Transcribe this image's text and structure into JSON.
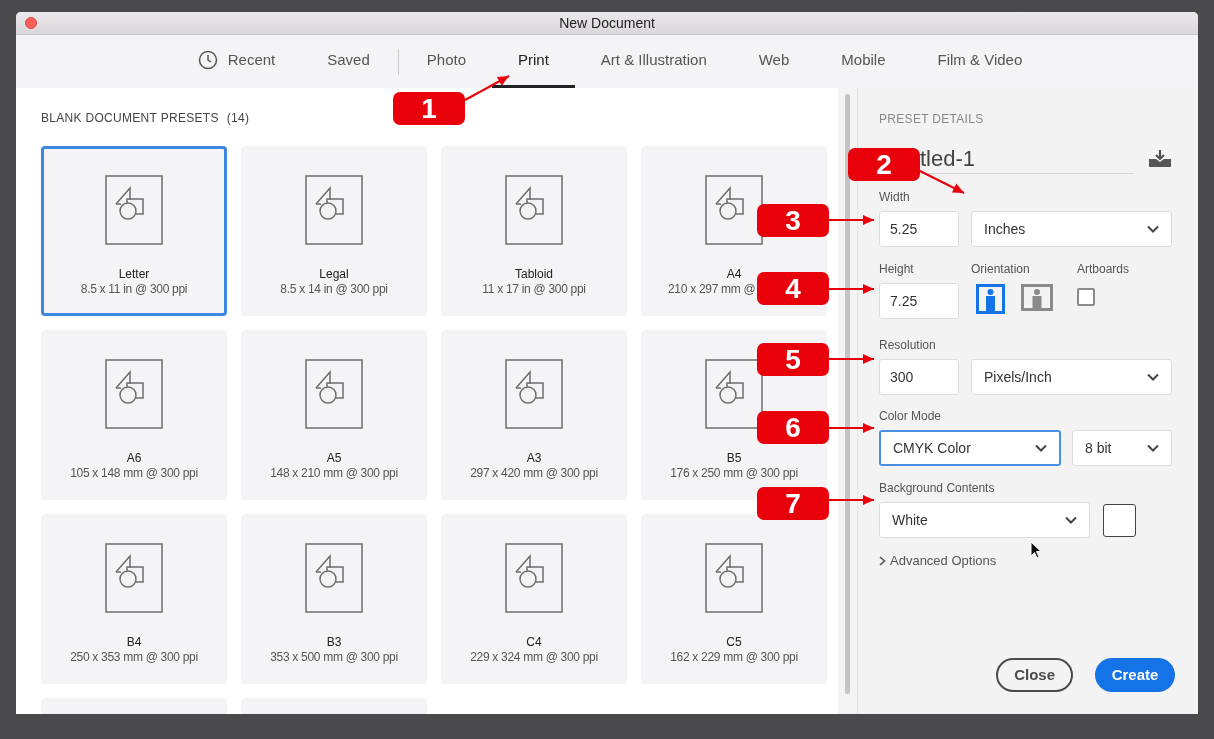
{
  "window": {
    "title": "New Document"
  },
  "tabs": [
    {
      "label": "Recent",
      "kind": "recent",
      "selected": false
    },
    {
      "label": "Saved",
      "kind": "plain",
      "selected": false
    },
    {
      "label": "Photo",
      "kind": "divided",
      "selected": false
    },
    {
      "label": "Print",
      "kind": "plain",
      "selected": true
    },
    {
      "label": "Art & Illustration",
      "kind": "plain",
      "selected": false
    },
    {
      "label": "Web",
      "kind": "plain",
      "selected": false
    },
    {
      "label": "Mobile",
      "kind": "plain",
      "selected": false
    },
    {
      "label": "Film & Video",
      "kind": "plain",
      "selected": false
    }
  ],
  "presets": {
    "heading": "BLANK DOCUMENT PRESETS",
    "count": "(14)",
    "items": [
      {
        "name": "Letter",
        "size": "8.5 x 11 in @ 300 ppi",
        "selected": true
      },
      {
        "name": "Legal",
        "size": "8.5 x 14 in @ 300 ppi",
        "selected": false
      },
      {
        "name": "Tabloid",
        "size": "11 x 17 in @ 300 ppi",
        "selected": false
      },
      {
        "name": "A4",
        "size": "210 x 297 mm @",
        "selected": false,
        "clipped": true
      },
      {
        "name": "A6",
        "size": "105 x 148 mm @ 300 ppi",
        "selected": false
      },
      {
        "name": "A5",
        "size": "148 x 210 mm @ 300 ppi",
        "selected": false
      },
      {
        "name": "A3",
        "size": "297 x 420 mm @ 300 ppi",
        "selected": false
      },
      {
        "name": "B5",
        "size": "176 x 250 mm @ 300 ppi",
        "selected": false
      },
      {
        "name": "B4",
        "size": "250 x 353 mm @ 300 ppi",
        "selected": false
      },
      {
        "name": "B3",
        "size": "353 x 500 mm @ 300 ppi",
        "selected": false
      },
      {
        "name": "C4",
        "size": "229 x 324 mm @ 300 ppi",
        "selected": false
      },
      {
        "name": "C5",
        "size": "162 x 229 mm @ 300 ppi",
        "selected": false
      }
    ],
    "cut_off_cards": [
      {
        "kind": "card"
      },
      {
        "kind": "card"
      }
    ]
  },
  "details": {
    "heading": "PRESET DETAILS",
    "doc_name": "tled-1",
    "width": {
      "label": "Width",
      "value": "5.25",
      "unit": "Inches"
    },
    "height": {
      "label": "Height",
      "value": "7.25"
    },
    "orientation": {
      "label": "Orientation",
      "options": [
        {
          "kind": "portrait",
          "selected": true
        },
        {
          "kind": "landscape",
          "selected": false
        }
      ]
    },
    "artboards": {
      "label": "Artboards",
      "checked": false
    },
    "resolution": {
      "label": "Resolution",
      "value": "300",
      "unit": "Pixels/Inch"
    },
    "color_mode": {
      "label": "Color Mode",
      "mode": "CMYK Color",
      "focused": true,
      "depth": "8 bit"
    },
    "background": {
      "label": "Background Contents",
      "value": "White"
    },
    "advanced": {
      "label": "Advanced Options",
      "expanded": false
    }
  },
  "buttons": [
    {
      "label": "Close",
      "kind": "secondary"
    },
    {
      "label": "Create",
      "kind": "primary"
    }
  ],
  "callouts": [
    {
      "number": "1"
    },
    {
      "number": "2"
    },
    {
      "number": "3"
    },
    {
      "number": "4"
    },
    {
      "number": "5"
    },
    {
      "number": "6"
    },
    {
      "number": "7"
    }
  ]
}
